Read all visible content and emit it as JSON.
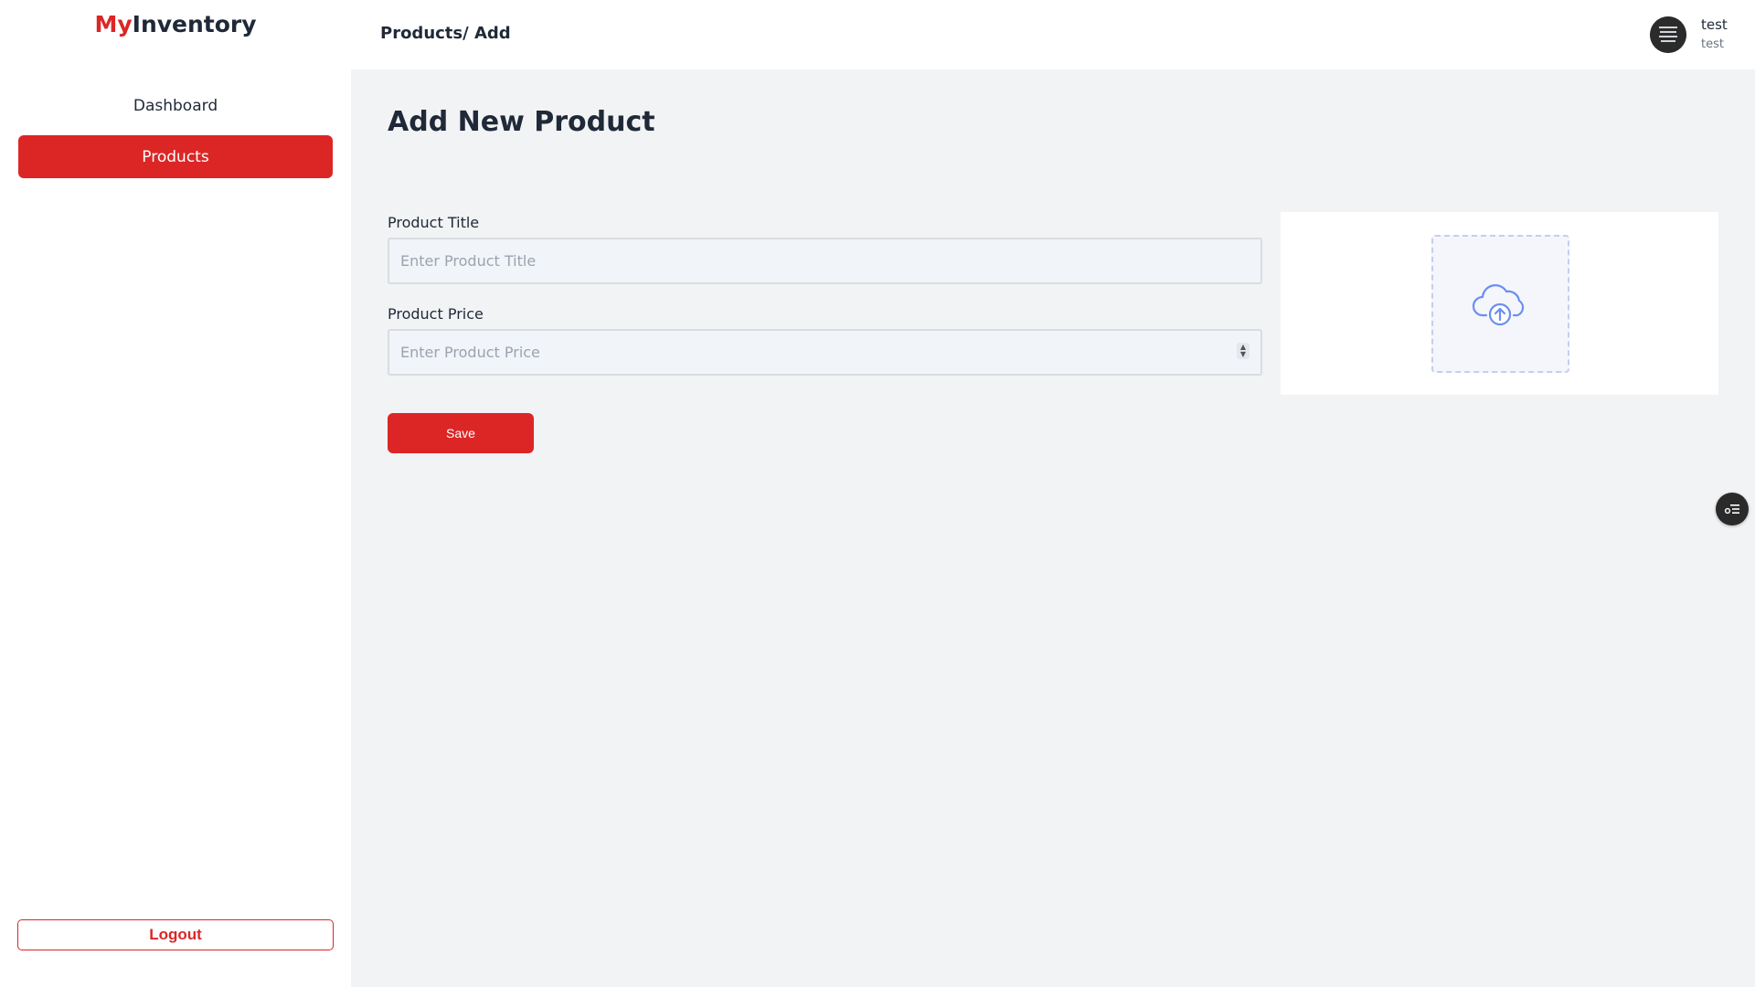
{
  "brand": {
    "prefix": "My",
    "suffix": "Inventory"
  },
  "sidebar": {
    "items": [
      {
        "label": "Dashboard",
        "active": false
      },
      {
        "label": "Products",
        "active": true
      }
    ],
    "logout_label": "Logout"
  },
  "header": {
    "breadcrumb": "Products/ Add",
    "user": {
      "name": "test",
      "role": "test",
      "avatar_icon": "avatar-image"
    }
  },
  "main": {
    "title": "Add New Product",
    "form": {
      "title_label": "Product Title",
      "title_placeholder": "Enter Product Title",
      "price_label": "Product Price",
      "price_placeholder": "Enter Product Price",
      "save_label": "Save"
    },
    "upload": {
      "icon": "cloud-upload-icon"
    }
  },
  "colors": {
    "accent": "#dc2626",
    "background": "#f2f3f5",
    "input_background": "#f1f4f8",
    "upload_icon": "#6b8ef0"
  }
}
